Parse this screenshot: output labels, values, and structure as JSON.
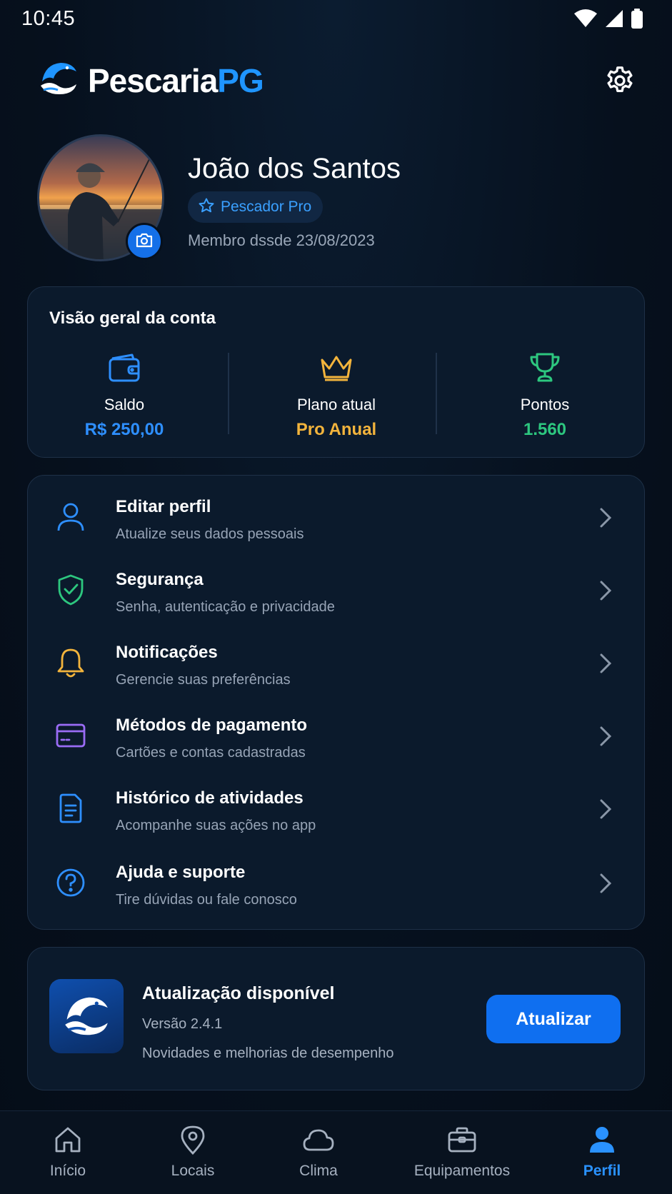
{
  "status_bar": {
    "time": "10:45",
    "icons": [
      "wifi-icon",
      "signal-icon",
      "battery-icon"
    ]
  },
  "header": {
    "logo_text_main": "Pescaria",
    "logo_text_accent": "PG",
    "settings_icon": "gear-icon"
  },
  "profile": {
    "name": "João dos Santos",
    "badge": "Pescador Pro",
    "member_since": "Membro dssde 23/08/2023"
  },
  "overview": {
    "title": "Visão geral da conta",
    "stats": [
      {
        "label": "Saldo",
        "value": "R$ 250,00",
        "icon": "wallet-icon",
        "color": "#2e8fff"
      },
      {
        "label": "Plano atual",
        "value": "Pro Anual",
        "icon": "crown-icon",
        "color": "#f3b43c"
      },
      {
        "label": "Pontos",
        "value": "1.560",
        "icon": "trophy-icon",
        "color": "#2dc77f"
      }
    ]
  },
  "menu": {
    "items": [
      {
        "title": "Editar perfil",
        "subtitle": "Atualize seus dados pessoais",
        "icon": "user-icon",
        "color": "#2e8fff"
      },
      {
        "title": "Segurança",
        "subtitle": "Senha, autenticação e privacidade",
        "icon": "shield-check-icon",
        "color": "#2dc77f"
      },
      {
        "title": "Notificações",
        "subtitle": "Gerencie suas preferências",
        "icon": "bell-icon",
        "color": "#f3b43c"
      },
      {
        "title": "Métodos de pagamento",
        "subtitle": "Cartões e contas cadastradas",
        "icon": "credit-card-icon",
        "color": "#9a6cf5"
      },
      {
        "title": "Histórico de atividades",
        "subtitle": "Acompanhe suas ações no app",
        "icon": "document-icon",
        "color": "#2e8fff"
      },
      {
        "title": "Ajuda e suporte",
        "subtitle": "Tire dúvidas ou fale conosco",
        "icon": "help-circle-icon",
        "color": "#2e8fff"
      }
    ]
  },
  "update": {
    "title": "Atualização disponível",
    "version": "Versão 2.4.1",
    "description": "Novidades e melhorias de desempenho",
    "button": "Atualizar"
  },
  "bottom_nav": {
    "items": [
      {
        "label": "Início",
        "icon": "home-icon",
        "active": false
      },
      {
        "label": "Locais",
        "icon": "map-pin-icon",
        "active": false
      },
      {
        "label": "Clima",
        "icon": "cloud-icon",
        "active": false
      },
      {
        "label": "Equipamentos",
        "icon": "briefcase-icon",
        "active": false
      },
      {
        "label": "Perfil",
        "icon": "user-filled-icon",
        "active": true
      }
    ]
  },
  "colors": {
    "accent": "#1f95ff",
    "background": "#06101d",
    "card": "#0b1a2c"
  }
}
